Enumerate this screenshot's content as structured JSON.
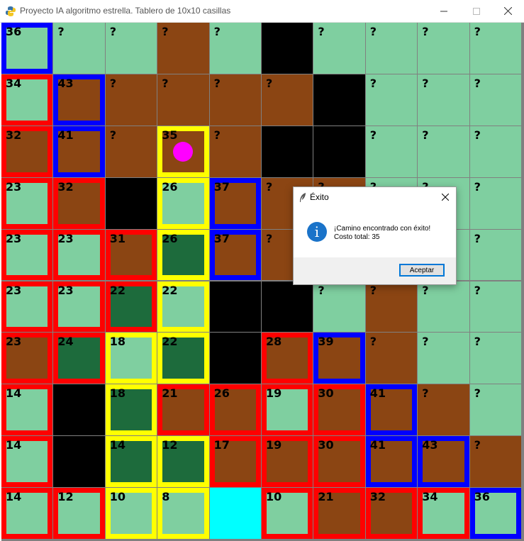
{
  "window": {
    "title": "Proyecto IA algoritmo estrella. Tablero de 10x10 casillas",
    "app_icon": "python-icon",
    "controls": [
      "minimize-icon",
      "maximize-icon",
      "close-icon"
    ]
  },
  "colors": {
    "unknown": "#7fcfa0",
    "open": "#7fcfa0",
    "mud": "#8b4513",
    "wall": "#000000",
    "path": "#1d6b3c",
    "goal": "#00ffff",
    "border_red": "#ff0000",
    "border_blue": "#0000ff",
    "border_yellow": "#ffff00",
    "agent": "#ff00ff"
  },
  "board": {
    "rows": 10,
    "cols": 10,
    "agent_cell": [
      2,
      3
    ],
    "cells": [
      [
        "36|G|B",
        "?|G|",
        "?|G|",
        "?|M|",
        "?|G|",
        "|W|",
        "?|G|",
        "?|G|",
        "?|G|",
        "?|G|"
      ],
      [
        "34|G|R",
        "43|M|B",
        "?|M|",
        "?|M|",
        "?|M|",
        "?|M|",
        "|W|",
        "?|G|",
        "?|G|",
        "?|G|"
      ],
      [
        "32|M|R",
        "41|M|B",
        "?|M|",
        "35|M|Y",
        "?|M|",
        "|W|",
        "|W|",
        "?|G|",
        "?|G|",
        "?|G|"
      ],
      [
        "23|G|R",
        "32|M|R",
        "|W|",
        "26|G|Y",
        "37|M|B",
        "?|M|",
        "?|M|",
        "?|G|",
        "?|G|",
        "?|G|"
      ],
      [
        "23|G|R",
        "23|G|R",
        "31|M|R",
        "26|P|Y",
        "37|M|B",
        "?|M|",
        "?|M|",
        "?|G|",
        "?|G|",
        "?|G|"
      ],
      [
        "23|G|R",
        "23|G|R",
        "22|P|R",
        "22|G|Y",
        "|W|",
        "|W|",
        "?|G|",
        "?|M|",
        "?|G|",
        "?|G|"
      ],
      [
        "23|M|R",
        "24|P|R",
        "18|G|Y",
        "22|P|Y",
        "|W|",
        "28|M|R",
        "39|M|B",
        "?|M|",
        "?|G|",
        "?|G|"
      ],
      [
        "14|G|R",
        "|W|",
        "18|P|Y",
        "21|M|R",
        "26|M|R",
        "19|G|R",
        "30|M|R",
        "41|M|B",
        "?|M|",
        "?|G|"
      ],
      [
        "14|G|R",
        "|W|",
        "14|P|Y",
        "12|P|Y",
        "17|M|R",
        "19|M|R",
        "30|M|R",
        "41|M|B",
        "43|M|B",
        "?|M|"
      ],
      [
        "14|G|R",
        "12|G|R",
        "10|G|Y",
        "8|G|Y",
        "|C|",
        "10|G|R",
        "21|M|R",
        "32|M|R",
        "34|G|R",
        "36|G|B"
      ]
    ]
  },
  "dialog": {
    "title": "Éxito",
    "icon": "info-icon",
    "message_line1": "¡Camino encontrado con éxito!",
    "message_line2": "Costo total: 35",
    "ok_label": "Aceptar"
  }
}
